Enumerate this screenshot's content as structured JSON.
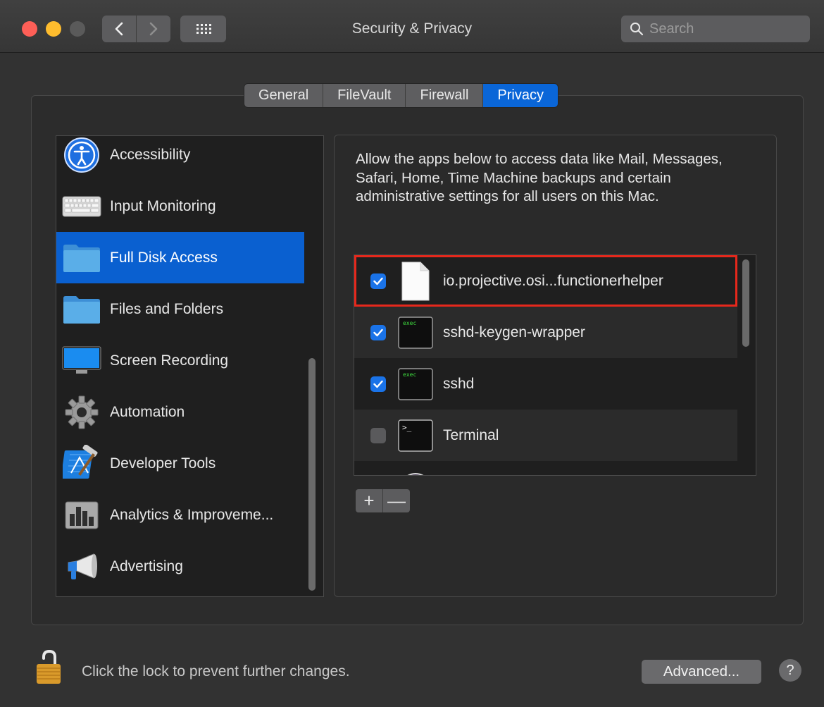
{
  "window": {
    "title": "Security & Privacy",
    "search_placeholder": "Search"
  },
  "tabs": [
    {
      "label": "General",
      "active": false
    },
    {
      "label": "FileVault",
      "active": false
    },
    {
      "label": "Firewall",
      "active": false
    },
    {
      "label": "Privacy",
      "active": true
    }
  ],
  "sidebar": {
    "items": [
      {
        "label": "Accessibility",
        "icon": "accessibility-icon",
        "selected": false
      },
      {
        "label": "Input Monitoring",
        "icon": "keyboard-icon",
        "selected": false
      },
      {
        "label": "Full Disk Access",
        "icon": "folder-icon",
        "selected": true
      },
      {
        "label": "Files and Folders",
        "icon": "folder-icon",
        "selected": false
      },
      {
        "label": "Screen Recording",
        "icon": "display-icon",
        "selected": false
      },
      {
        "label": "Automation",
        "icon": "gear-icon",
        "selected": false
      },
      {
        "label": "Developer Tools",
        "icon": "xcode-hammer-icon",
        "selected": false
      },
      {
        "label": "Analytics & Improveme...",
        "icon": "bar-chart-icon",
        "selected": false
      },
      {
        "label": "Advertising",
        "icon": "megaphone-icon",
        "selected": false
      }
    ]
  },
  "main": {
    "description": "Allow the apps below to access data like Mail, Messages, Safari, Home, Time Machine backups and certain administrative settings for all users on this Mac.",
    "apps": [
      {
        "label": "io.projective.osi...functionerhelper",
        "checked": true,
        "icon": "document-icon",
        "highlighted": true
      },
      {
        "label": "sshd-keygen-wrapper",
        "checked": true,
        "icon": "exec-icon",
        "icon_text": "exec"
      },
      {
        "label": "sshd",
        "checked": true,
        "icon": "exec-icon",
        "icon_text": "exec"
      },
      {
        "label": "Terminal",
        "checked": false,
        "icon": "terminal-icon",
        "icon_text": ">_"
      }
    ],
    "add_label": "+",
    "remove_label": "—"
  },
  "footer": {
    "lock_text": "Click the lock to prevent further changes.",
    "advanced_label": "Advanced...",
    "help_label": "?"
  },
  "colors": {
    "accent": "#0a60d0",
    "highlight_border": "#e6281c",
    "close": "#fe5f57",
    "minimize": "#febc2e"
  }
}
